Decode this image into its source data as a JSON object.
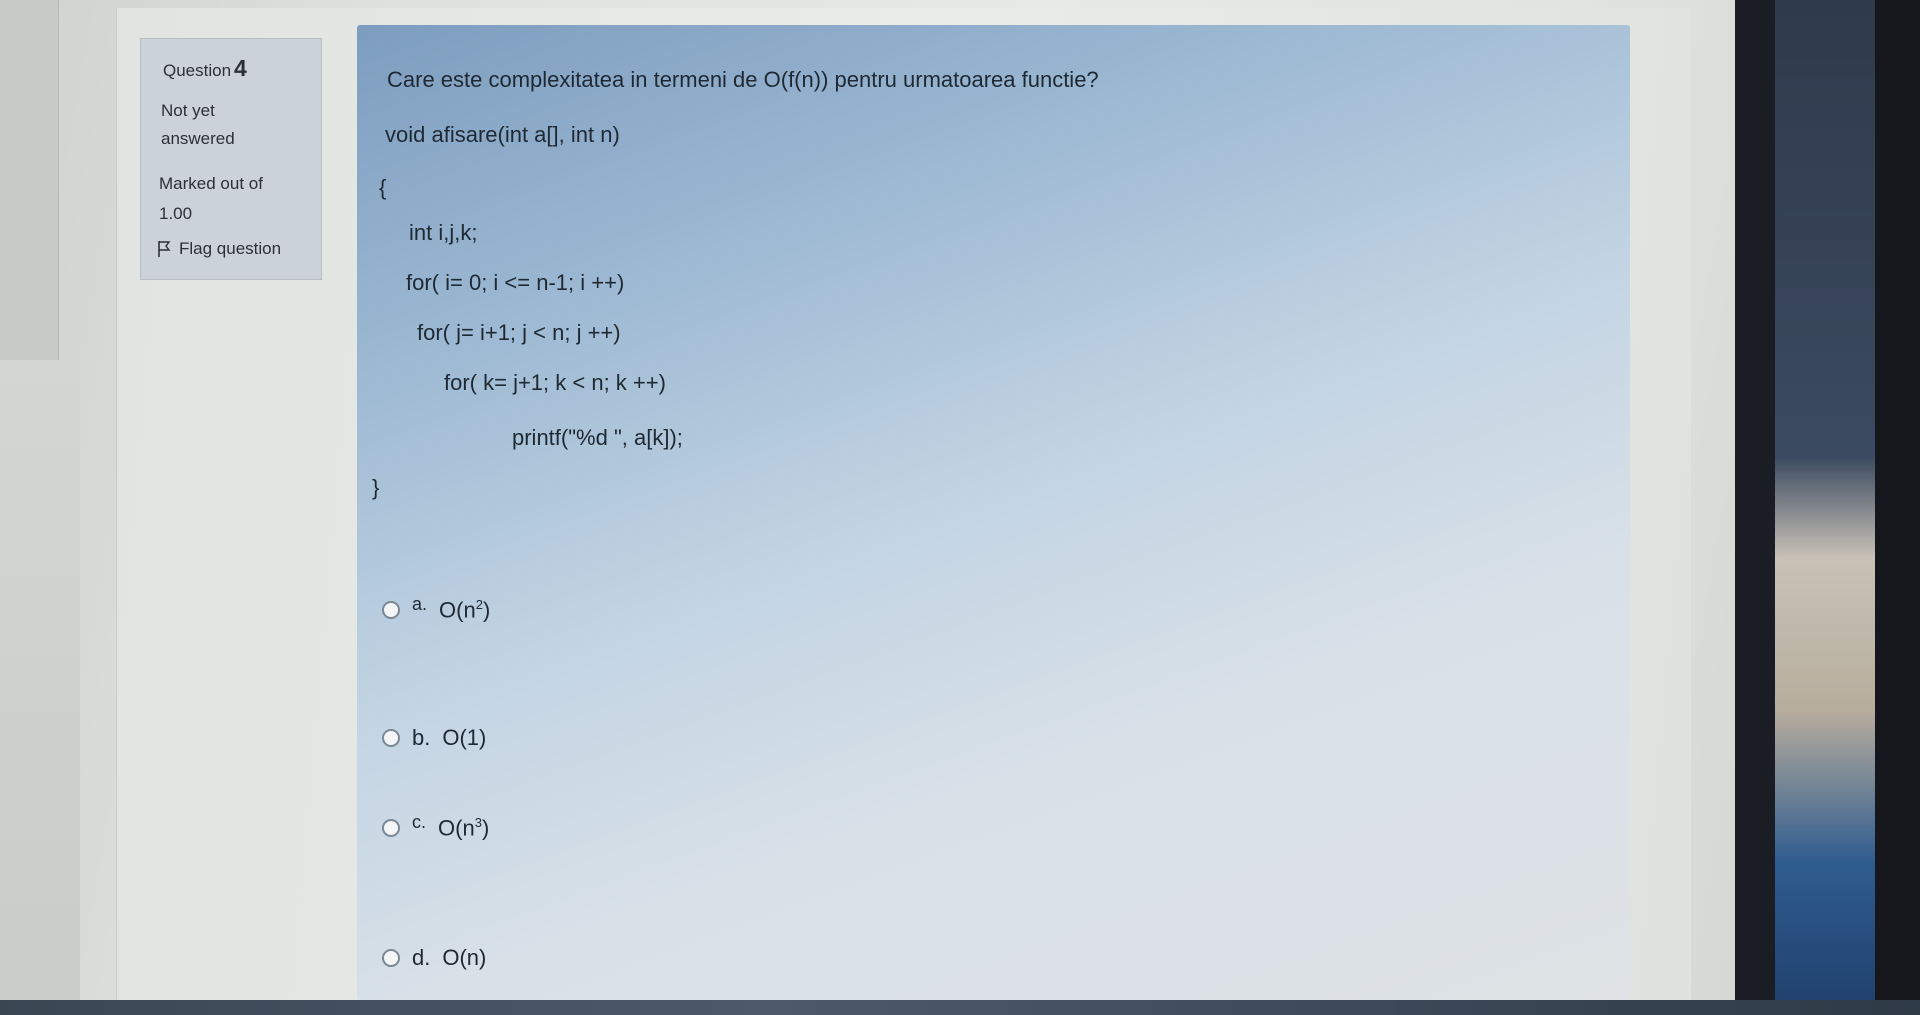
{
  "question_info": {
    "label": "Question",
    "number": "4",
    "state_line1": "Not yet",
    "state_line2": "answered",
    "grade_line1": "Marked out of",
    "grade_line2": "1.00",
    "flag_label": "Flag question",
    "flag_icon": "flag-icon"
  },
  "question": {
    "text": "Care este complexitatea in termeni de O(f(n)) pentru urmatoarea functie?",
    "code": [
      "void afisare(int a[], int n)",
      "{",
      "int i,j,k;",
      "for( i= 0; i <= n-1; i ++)",
      "for( j= i+1; j < n; j ++)",
      "for( k= j+1; k < n; k ++)",
      "printf(\"%d \", a[k]);",
      "}"
    ]
  },
  "answers": [
    {
      "letter": "a.",
      "text_base": "O(n",
      "exponent": "2",
      "text_end": ")"
    },
    {
      "letter": "b.",
      "text": "O(1)"
    },
    {
      "letter": "c.",
      "text_base": "O(n",
      "exponent": "3",
      "text_end": ")"
    },
    {
      "letter": "d.",
      "text": "O(n)"
    }
  ]
}
